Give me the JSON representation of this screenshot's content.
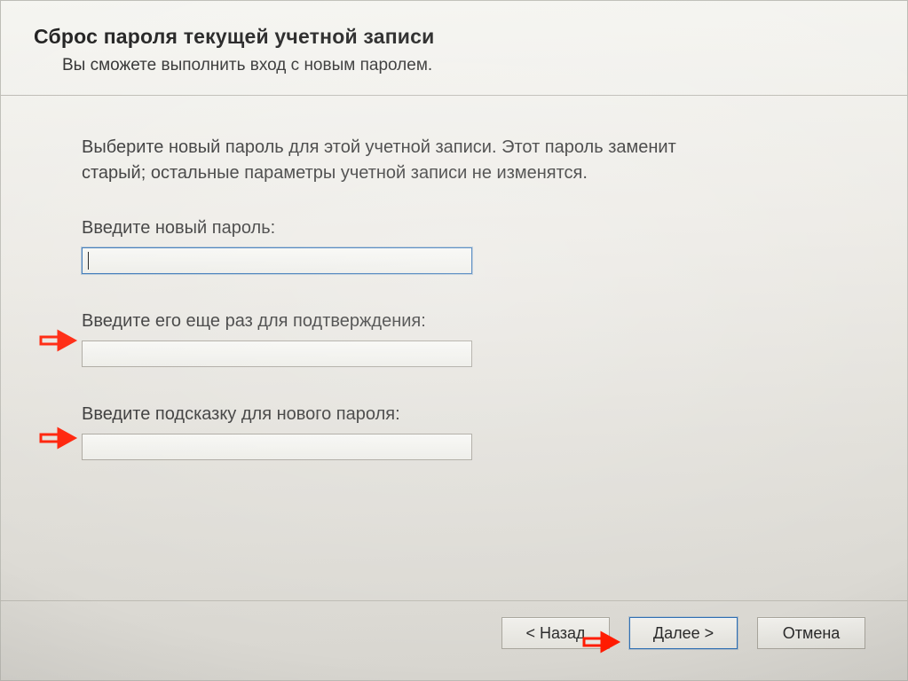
{
  "header": {
    "title": "Сброс пароля текущей учетной записи",
    "subtitle": "Вы сможете выполнить вход с новым паролем."
  },
  "content": {
    "intro": "Выберите новый пароль для этой учетной записи. Этот пароль заменит старый; остальные параметры учетной записи не изменятся.",
    "new_password_label": "Введите новый пароль:",
    "confirm_password_label": "Введите его еще раз для подтверждения:",
    "hint_label": "Введите подсказку для нового пароля:"
  },
  "buttons": {
    "back": "< Назад",
    "next": "Далее >",
    "cancel": "Отмена"
  },
  "fields": {
    "new_password_value": "",
    "confirm_password_value": "",
    "hint_value": ""
  }
}
